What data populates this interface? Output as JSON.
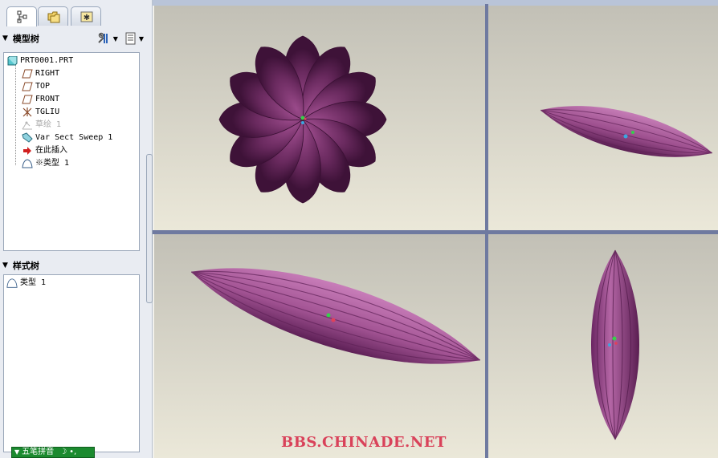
{
  "colors": {
    "accent": "#e0405a",
    "part": "#7a2f66",
    "ime_bg": "#1b8a2f"
  },
  "tabs": [
    {
      "name": "model-tree-tab",
      "icon": "tree-icon"
    },
    {
      "name": "folder-tab",
      "icon": "folder-icon"
    },
    {
      "name": "favorites-tab",
      "icon": "star-icon"
    }
  ],
  "model_tree": {
    "title": "模型树",
    "tools": [
      "settings-icon",
      "show-icon"
    ],
    "items": [
      {
        "label": "PRT0001.PRT",
        "icon": "part-icon"
      },
      {
        "label": "RIGHT",
        "icon": "datum-plane-icon"
      },
      {
        "label": "TOP",
        "icon": "datum-plane-icon"
      },
      {
        "label": "FRONT",
        "icon": "datum-plane-icon"
      },
      {
        "label": "TGLIU",
        "icon": "csys-icon"
      },
      {
        "label": "草绘 1",
        "icon": "sketch-icon"
      },
      {
        "label": "Var Sect Sweep 1",
        "icon": "sweep-icon"
      },
      {
        "label": "在此插入",
        "icon": "insert-arrow-icon"
      },
      {
        "label": "※类型 1",
        "icon": "style-icon"
      }
    ]
  },
  "style_tree": {
    "title": "样式树",
    "items": [
      {
        "label": "类型 1",
        "icon": "style-icon"
      }
    ]
  },
  "ime": {
    "label": "五笔拼音",
    "moon": "☽",
    "punct": "•,"
  },
  "watermark": "BBS.CHINADE.NET"
}
